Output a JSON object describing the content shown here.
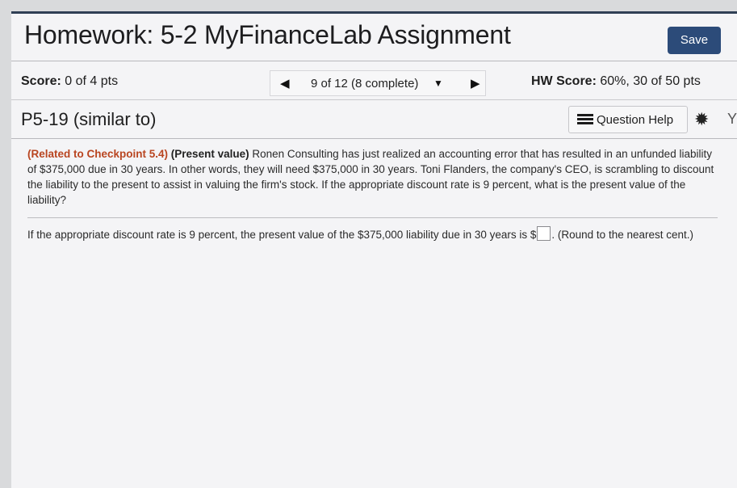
{
  "header": {
    "title": "Homework: 5-2 MyFinanceLab Assignment",
    "save_label": "Save"
  },
  "scorebar": {
    "score_label": "Score:",
    "score_value": "0 of 4 pts",
    "nav_text": "9 of 12 (8 complete)",
    "hw_label": "HW Score:",
    "hw_value": "60%, 30 of 50 pts"
  },
  "question": {
    "id": "P5-19 (similar to)",
    "help_label": "Question Help",
    "cutoff_char": "Y"
  },
  "problem": {
    "related": "(Related to Checkpoint 5.4)",
    "topic": "(Present value)",
    "text": "Ronen Consulting has just realized an accounting error that has resulted in an unfunded liability of $375,000 due in 30 years.  In other words, they will need $375,000 in 30 years.  Toni Flanders, the company's CEO, is scrambling to discount the liability to the present to assist in valuing the firm's stock.  If the appropriate discount rate is 9 percent, what is the present value of the liability?"
  },
  "answer": {
    "prompt_before": "If the appropriate discount rate is 9 percent, the present value of the $375,000 liability due in 30 years is $",
    "prompt_after": ".  (Round to the nearest cent.)",
    "value": ""
  },
  "icons": {
    "prev": "left-triangle-icon",
    "next": "right-triangle-icon",
    "dropdown": "dropdown-triangle-icon",
    "help": "list-icon",
    "settings": "gear-icon"
  },
  "colors": {
    "accent": "#2c4b79",
    "related": "#b94520"
  }
}
